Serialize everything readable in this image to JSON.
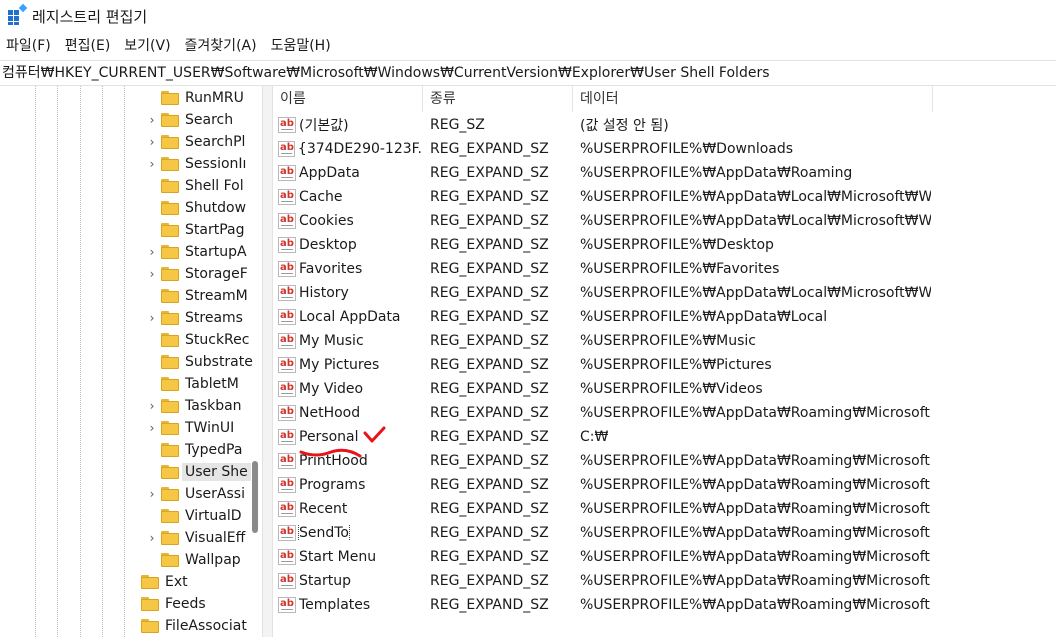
{
  "window": {
    "title": "레지스트리 편집기"
  },
  "menu": [
    "파일(F)",
    "편집(E)",
    "보기(V)",
    "즐겨찾기(A)",
    "도움말(H)"
  ],
  "address": "컴퓨터₩HKEY_CURRENT_USER₩Software₩Microsoft₩Windows₩CurrentVersion₩Explorer₩User Shell Folders",
  "tree": {
    "items": [
      {
        "label": "RunMRU",
        "expandable": false,
        "level": 2,
        "selected": false
      },
      {
        "label": "Search",
        "expandable": true,
        "level": 2,
        "selected": false
      },
      {
        "label": "SearchPl",
        "expandable": true,
        "level": 2,
        "selected": false
      },
      {
        "label": "SessionIı",
        "expandable": true,
        "level": 2,
        "selected": false
      },
      {
        "label": "Shell Fol",
        "expandable": false,
        "level": 2,
        "selected": false
      },
      {
        "label": "Shutdow",
        "expandable": false,
        "level": 2,
        "selected": false
      },
      {
        "label": "StartPag",
        "expandable": false,
        "level": 2,
        "selected": false
      },
      {
        "label": "StartupA",
        "expandable": true,
        "level": 2,
        "selected": false
      },
      {
        "label": "StorageF",
        "expandable": true,
        "level": 2,
        "selected": false
      },
      {
        "label": "StreamM",
        "expandable": false,
        "level": 2,
        "selected": false
      },
      {
        "label": "Streams",
        "expandable": true,
        "level": 2,
        "selected": false
      },
      {
        "label": "StuckRec",
        "expandable": false,
        "level": 2,
        "selected": false
      },
      {
        "label": "Substrate",
        "expandable": false,
        "level": 2,
        "selected": false
      },
      {
        "label": "TabletM",
        "expandable": false,
        "level": 2,
        "selected": false
      },
      {
        "label": "Taskban",
        "expandable": true,
        "level": 2,
        "selected": false
      },
      {
        "label": "TWinUI",
        "expandable": true,
        "level": 2,
        "selected": false
      },
      {
        "label": "TypedPa",
        "expandable": false,
        "level": 2,
        "selected": false
      },
      {
        "label": "User She",
        "expandable": false,
        "level": 2,
        "selected": true
      },
      {
        "label": "UserAssi",
        "expandable": true,
        "level": 2,
        "selected": false
      },
      {
        "label": "VirtualD",
        "expandable": false,
        "level": 2,
        "selected": false
      },
      {
        "label": "VisualEff",
        "expandable": true,
        "level": 2,
        "selected": false
      },
      {
        "label": "Wallpap",
        "expandable": false,
        "level": 2,
        "selected": false
      },
      {
        "label": "Ext",
        "expandable": false,
        "level": 1,
        "selected": false
      },
      {
        "label": "Feeds",
        "expandable": false,
        "level": 1,
        "selected": false
      },
      {
        "label": "FileAssociat",
        "expandable": false,
        "level": 1,
        "selected": false
      }
    ]
  },
  "list": {
    "columns": [
      "이름",
      "종류",
      "데이터"
    ],
    "rows": [
      {
        "name": "(기본값)",
        "type": "REG_SZ",
        "data": "(값 설정 안 됨)"
      },
      {
        "name": "{374DE290-123F...",
        "type": "REG_EXPAND_SZ",
        "data": "%USERPROFILE%₩Downloads"
      },
      {
        "name": "AppData",
        "type": "REG_EXPAND_SZ",
        "data": "%USERPROFILE%₩AppData₩Roaming"
      },
      {
        "name": "Cache",
        "type": "REG_EXPAND_SZ",
        "data": "%USERPROFILE%₩AppData₩Local₩Microsoft₩Wi..."
      },
      {
        "name": "Cookies",
        "type": "REG_EXPAND_SZ",
        "data": "%USERPROFILE%₩AppData₩Local₩Microsoft₩Wi..."
      },
      {
        "name": "Desktop",
        "type": "REG_EXPAND_SZ",
        "data": "%USERPROFILE%₩Desktop"
      },
      {
        "name": "Favorites",
        "type": "REG_EXPAND_SZ",
        "data": "%USERPROFILE%₩Favorites"
      },
      {
        "name": "History",
        "type": "REG_EXPAND_SZ",
        "data": "%USERPROFILE%₩AppData₩Local₩Microsoft₩Wi..."
      },
      {
        "name": "Local AppData",
        "type": "REG_EXPAND_SZ",
        "data": "%USERPROFILE%₩AppData₩Local"
      },
      {
        "name": "My Music",
        "type": "REG_EXPAND_SZ",
        "data": "%USERPROFILE%₩Music"
      },
      {
        "name": "My Pictures",
        "type": "REG_EXPAND_SZ",
        "data": "%USERPROFILE%₩Pictures"
      },
      {
        "name": "My Video",
        "type": "REG_EXPAND_SZ",
        "data": "%USERPROFILE%₩Videos"
      },
      {
        "name": "NetHood",
        "type": "REG_EXPAND_SZ",
        "data": "%USERPROFILE%₩AppData₩Roaming₩Microsoft..."
      },
      {
        "name": "Personal",
        "type": "REG_EXPAND_SZ",
        "data": "C:₩"
      },
      {
        "name": "PrintHood",
        "type": "REG_EXPAND_SZ",
        "data": "%USERPROFILE%₩AppData₩Roaming₩Microsoft..."
      },
      {
        "name": "Programs",
        "type": "REG_EXPAND_SZ",
        "data": "%USERPROFILE%₩AppData₩Roaming₩Microsoft..."
      },
      {
        "name": "Recent",
        "type": "REG_EXPAND_SZ",
        "data": "%USERPROFILE%₩AppData₩Roaming₩Microsoft..."
      },
      {
        "name": "SendTo",
        "type": "REG_EXPAND_SZ",
        "data": "%USERPROFILE%₩AppData₩Roaming₩Microsoft..."
      },
      {
        "name": "Start Menu",
        "type": "REG_EXPAND_SZ",
        "data": "%USERPROFILE%₩AppData₩Roaming₩Microsoft..."
      },
      {
        "name": "Startup",
        "type": "REG_EXPAND_SZ",
        "data": "%USERPROFILE%₩AppData₩Roaming₩Microsoft..."
      },
      {
        "name": "Templates",
        "type": "REG_EXPAND_SZ",
        "data": "%USERPROFILE%₩AppData₩Roaming₩Microsoft..."
      }
    ],
    "focused_row": "SendTo",
    "value_icon": "string-value-icon"
  },
  "annotation": {
    "color": "#e8141b",
    "highlighted_row": "Personal"
  }
}
